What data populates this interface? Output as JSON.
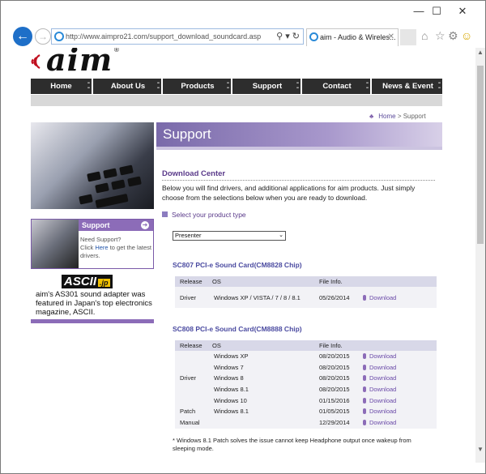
{
  "browser": {
    "minimize": "—",
    "maximize": "☐",
    "close": "✕",
    "back_icon": "←",
    "forward_icon": "→",
    "url": "http://www.aimpro21.com/support_download_soundcard.asp",
    "addr_tools": "⚲ ▾ ↻",
    "tab_title": "aim - Audio & Wireles...",
    "tab_close": "✕",
    "home_icon": "⌂",
    "favorites_icon": "☆",
    "settings_icon": "⚙",
    "smiley_icon": "☺",
    "scroll_up": "▲",
    "scroll_down": "▼"
  },
  "site": {
    "logo": "aim",
    "logo_reg": "®",
    "nav": [
      "Home",
      "About Us",
      "Products",
      "Support",
      "Contact",
      "News & Event"
    ],
    "breadcrumb": {
      "home": "Home",
      "sep": " > ",
      "current": "Support"
    }
  },
  "sidebar": {
    "support_title": "Support",
    "support_text_1": "Need Support?",
    "support_text_2": "Click ",
    "support_link": "Here",
    "support_text_3": " to get the latest drivers.",
    "ascii_logo": "ASCII",
    "ascii_jp": ".jp",
    "ascii_text": "aim's AS301 sound adapter was featured in Japan's top electronics magazine, ASCII."
  },
  "main": {
    "banner_title": "Support",
    "dc_title": "Download Center",
    "dc_text": "Below you will find drivers, and additional applications for aim products. Just simply choose from the selections below when you are ready to download.",
    "select_label": "Select your product type",
    "select_value": "Presenter",
    "products": [
      {
        "title": "SC807 PCI-e  Sound Card(CM8828 Chip)",
        "headers": [
          "Release",
          "OS",
          "File Info."
        ],
        "rows": [
          {
            "release": "Driver",
            "os": "Windows XP / VISTA / 7 / 8 / 8.1",
            "date": "05/26/2014",
            "link": "Download"
          }
        ]
      },
      {
        "title": "SC808 PCI-e  Sound Card(CM8888 Chip)",
        "headers": [
          "Release",
          "OS",
          "File Info."
        ],
        "rows": [
          {
            "release": "",
            "os": "Windows XP",
            "date": "08/20/2015",
            "link": "Download"
          },
          {
            "release": "",
            "os": "Windows 7",
            "date": "08/20/2015",
            "link": "Download"
          },
          {
            "release": "Driver",
            "os": "Windows 8",
            "date": "08/20/2015",
            "link": "Download"
          },
          {
            "release": "",
            "os": "Windows 8.1",
            "date": "08/20/2015",
            "link": "Download"
          },
          {
            "release": "",
            "os": "Windows 10",
            "date": "01/15/2016",
            "link": "Download"
          },
          {
            "release": "Patch",
            "os": "Windows  8.1",
            "date": "01/05/2015",
            "link": "Download"
          },
          {
            "release": "Manual",
            "os": "",
            "date": "12/29/2014",
            "link": "Download"
          }
        ]
      }
    ],
    "footnote": "* Windows 8.1 Patch solves the issue cannot keep Headphone output once wakeup from sleeping mode."
  }
}
